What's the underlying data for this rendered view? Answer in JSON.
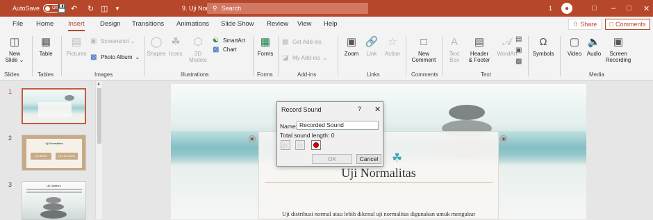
{
  "titlebar": {
    "autosave_label": "AutoSave",
    "autosave_state": "Off",
    "doc_name": "9. Uji Nor...  ⌄",
    "search_placeholder": "Search",
    "notification_count": "1",
    "accent_color": "#b7472a"
  },
  "tabs": [
    "File",
    "Home",
    "Insert",
    "Design",
    "Transitions",
    "Animations",
    "Slide Show",
    "Review",
    "View",
    "Help"
  ],
  "active_tab": "Insert",
  "share_label": "Share",
  "comments_label": "Comments",
  "ribbon": {
    "new_slide": "New\nSlide ⌄",
    "table": "Table",
    "pictures": "Pictures",
    "screenshot": "Screenshot ⌄",
    "photo_album": "Photo Album",
    "shapes": "Shapes",
    "icons": "Icons",
    "models_3d": "3D\nModels",
    "smartart": "SmartArt",
    "chart": "Chart",
    "forms": "Forms",
    "get_addins": "Get Add-ins",
    "my_addins": "My Add-ins",
    "zoom": "Zoom",
    "link": "Link",
    "action": "Action",
    "new_comment": "New\nComment",
    "text_box": "Text\nBox",
    "header_footer": "Header\n& Footer",
    "wordart": "WordArt",
    "symbols": "Symbols",
    "video": "Video",
    "audio": "Audio",
    "screen_recording": "Screen\nRecording",
    "groups": [
      "Slides",
      "Tables",
      "Images",
      "Illustrations",
      "Forms",
      "Add-ins",
      "Links",
      "Comments",
      "Text",
      "Media"
    ]
  },
  "thumbnails": [
    {
      "num": "1",
      "selected": true
    },
    {
      "num": "2",
      "selected": false
    },
    {
      "num": "3",
      "selected": false
    }
  ],
  "thumb_texts": {
    "slide2_title": "Uji Normalitas",
    "slide2_btn1": "Uji Lilliefors",
    "slide2_btn2": "Uji Chi-Kuadrat",
    "slide3_title": "Uji Lilliefors"
  },
  "slide": {
    "title": "Uji Normalitas",
    "body_text": "Uji distribusi normal atau lebih dikenal uji normalitas digunakan untuk mengukur"
  },
  "dialog": {
    "title": "Record Sound",
    "help": "?",
    "close": "✕",
    "name_label": "Name:",
    "name_value": "Recorded Sound",
    "length_label": "Total sound length:  0",
    "ok_label": "OK",
    "cancel_label": "Cancel"
  }
}
